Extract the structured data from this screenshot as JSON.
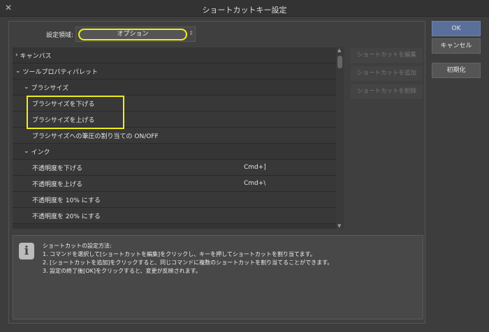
{
  "window": {
    "title": "ショートカットキー設定",
    "close": "✕"
  },
  "area": {
    "label": "設定領域:",
    "value": "オプション"
  },
  "list": [
    {
      "label": "キャンバス",
      "indent": 0,
      "expander": "›",
      "shortcut": ""
    },
    {
      "label": "ツールプロパティパレット",
      "indent": 0,
      "expander": "⌄",
      "shortcut": ""
    },
    {
      "label": "ブラシサイズ",
      "indent": 1,
      "expander": "⌄",
      "shortcut": ""
    },
    {
      "label": "ブラシサイズを下げる",
      "indent": 2,
      "expander": "",
      "shortcut": ""
    },
    {
      "label": "ブラシサイズを上げる",
      "indent": 2,
      "expander": "",
      "shortcut": ""
    },
    {
      "label": "ブラシサイズへの筆圧の割り当ての ON/OFF",
      "indent": 2,
      "expander": "",
      "shortcut": ""
    },
    {
      "label": "インク",
      "indent": 1,
      "expander": "⌄",
      "shortcut": ""
    },
    {
      "label": "不透明度を下げる",
      "indent": 2,
      "expander": "",
      "shortcut": "Cmd+]"
    },
    {
      "label": "不透明度を上げる",
      "indent": 2,
      "expander": "",
      "shortcut": "Cmd+\\"
    },
    {
      "label": "不透明度を 10% にする",
      "indent": 2,
      "expander": "",
      "shortcut": ""
    },
    {
      "label": "不透明度を 20% にする",
      "indent": 2,
      "expander": "",
      "shortcut": ""
    }
  ],
  "side_buttons": {
    "edit": "ショートカットを編集",
    "add": "ショートカットを追加",
    "delete": "ショートカットを削除"
  },
  "dialog_buttons": {
    "ok": "OK",
    "cancel": "キャンセル",
    "reset": "初期化"
  },
  "info": {
    "icon": "i",
    "heading": "ショートカットの設定方法:",
    "line1": "1. コマンドを選択して[ショートカットを編集]をクリックし、キーを押してショートカットを割り当てます。",
    "line2": "2. [ショートカットを追加]をクリックすると、同じコマンドに複数のショートカットを割り当てることができます。",
    "line3": "3. 設定の終了後[OK]をクリックすると、変更が反映されます。"
  }
}
